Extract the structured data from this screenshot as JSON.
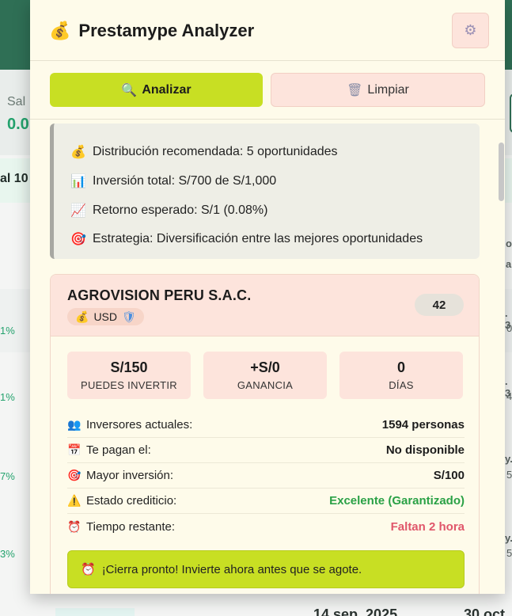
{
  "background": {
    "saldo_label": "Sal",
    "saldo_value": "0.0",
    "total_label": "al 10",
    "pcts": [
      "1%",
      "1%",
      "7%",
      "3%"
    ],
    "right_snippets": [
      "o",
      "a",
      ". 3",
      "0",
      ". 3",
      "4",
      "y.",
      "5",
      "y.",
      "5"
    ],
    "footer_date": "14 sep. 2025",
    "footer_date2": "30 oct"
  },
  "popup": {
    "title_icon": "money-bag",
    "title": "Prestamype Analyzer",
    "settings_icon": "gear"
  },
  "actions": {
    "analyze_icon": "magnifier",
    "analyze_label": "Analizar",
    "clear_icon": "trash",
    "clear_label": "Limpiar"
  },
  "summary": {
    "lines": [
      {
        "icon": "money-bag",
        "text": "Distribución recomendada: 5 oportunidades"
      },
      {
        "icon": "bar-chart",
        "text": "Inversión total: S/700 de S/1,000"
      },
      {
        "icon": "trend-up",
        "text": "Retorno esperado: S/1 (0.08%)"
      },
      {
        "icon": "target",
        "text": "Estrategia: Diversificación entre las mejores oportunidades"
      }
    ]
  },
  "card": {
    "company": "AGROVISION PERU S.A.C.",
    "currency": "USD",
    "score": "42",
    "stats": [
      {
        "value": "S/150",
        "label": "PUEDES INVERTIR"
      },
      {
        "value": "+S/0",
        "label": "GANANCIA"
      },
      {
        "value": "0",
        "label": "DÍAS"
      }
    ],
    "details": [
      {
        "icon": "people",
        "label": "Inversores actuales:",
        "value": "1594 personas",
        "tone": "normal"
      },
      {
        "icon": "calendar",
        "label": "Te pagan el:",
        "value": "No disponible",
        "tone": "normal"
      },
      {
        "icon": "target",
        "label": "Mayor inversión:",
        "value": "S/100",
        "tone": "normal"
      },
      {
        "icon": "warning",
        "label": "Estado crediticio:",
        "value": "Excelente (Garantizado)",
        "tone": "good"
      },
      {
        "icon": "alarm-clock",
        "label": "Tiempo restante:",
        "value": "Faltan 2 hora",
        "tone": "warn"
      }
    ],
    "alert": "¡Cierra pronto! Invierte ahora antes que se agote."
  },
  "colors": {
    "accent": "#c8df23",
    "soft_pink": "#fde4dc",
    "good": "#2aa146",
    "warn": "#e0566a"
  }
}
